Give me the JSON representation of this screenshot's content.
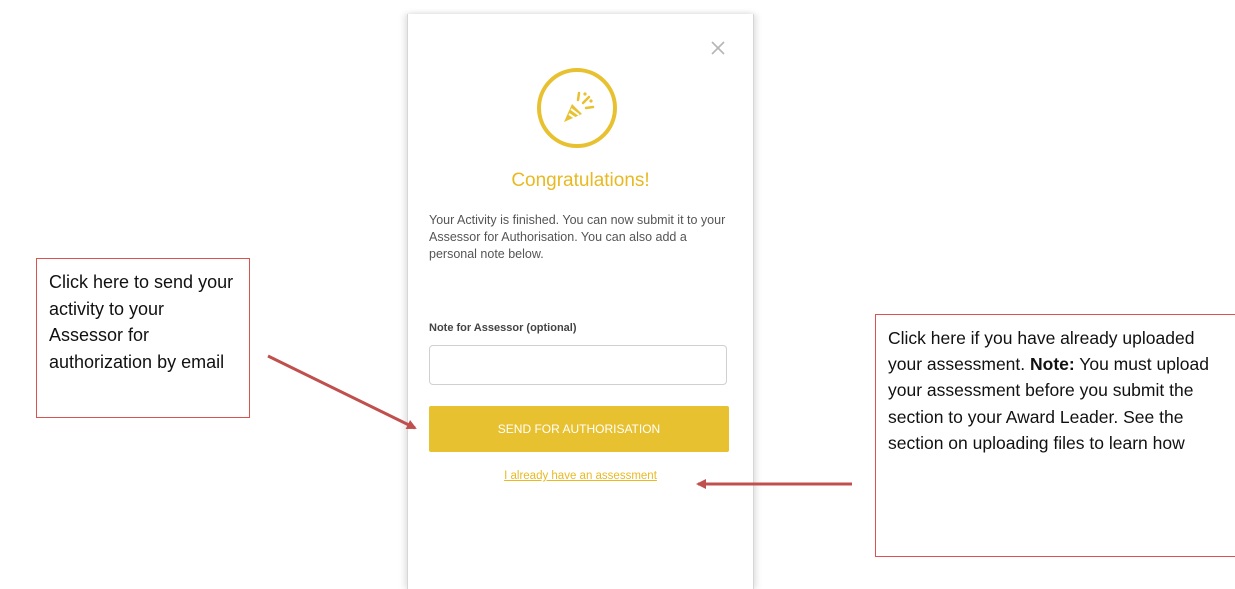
{
  "modal": {
    "close_icon": "close-icon",
    "badge_icon": "party-popper-icon",
    "accent_color": "#e8c131",
    "title": "Congratulations!",
    "body": "Your Activity is finished. You can now submit it to your Assessor for Authorisation. You can also add a personal note below.",
    "note_label": "Note for Assessor (optional)",
    "note_value": "",
    "send_button": "SEND FOR AUTHORISATION",
    "assessment_link": "I already have an assessment"
  },
  "annotations": {
    "color": "#d9534f",
    "left_callout": "Click here to send your activity to your Assessor for authorization by email",
    "right_callout_intro": "Click here if you have already uploaded your assessment.",
    "right_callout_note_label": "Note:",
    "right_callout_rest": "You must upload your assessment before you submit the section to your Award Leader.  See the section on uploading files to learn how"
  }
}
